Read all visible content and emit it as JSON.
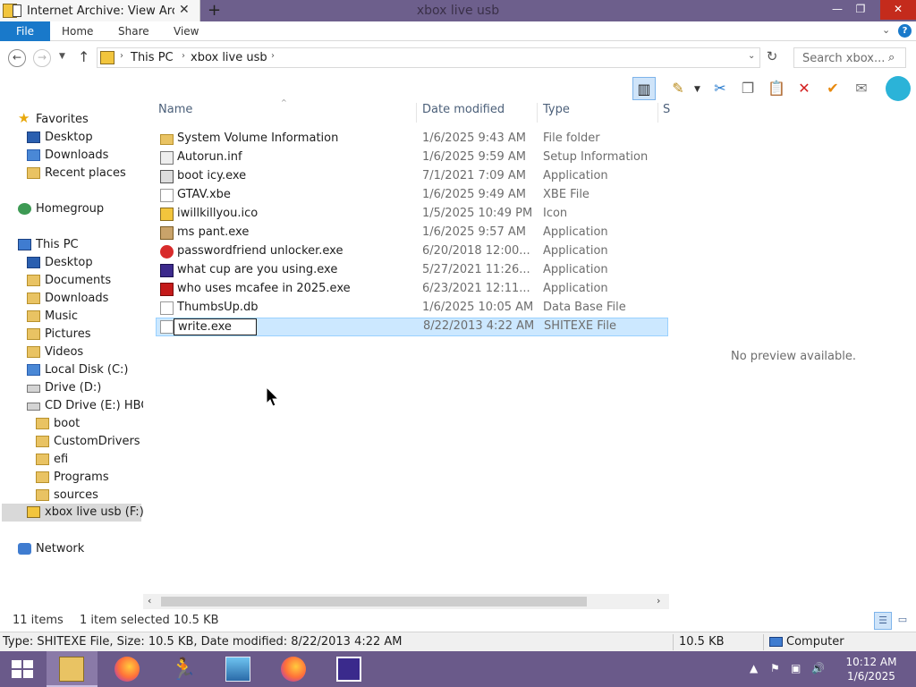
{
  "window": {
    "tab_title": "Internet Archive: View Arc",
    "title": "xbox live usb",
    "min": "—",
    "max": "❐",
    "close": "✕",
    "newtab": "+"
  },
  "ribbon": {
    "tabs": [
      "File",
      "Home",
      "Share",
      "View"
    ]
  },
  "address": {
    "crumbs": [
      "This PC",
      "xbox live usb"
    ],
    "search_placeholder": "Search xbox..."
  },
  "columns": {
    "name": "Name",
    "date": "Date modified",
    "type": "Type",
    "size": "S"
  },
  "nav": {
    "favorites": "Favorites",
    "favorites_items": [
      "Desktop",
      "Downloads",
      "Recent places"
    ],
    "homegroup": "Homegroup",
    "this_pc": "This PC",
    "pc_items": [
      "Desktop",
      "Documents",
      "Downloads",
      "Music",
      "Pictures",
      "Videos",
      "Local Disk (C:)",
      "Drive (D:)",
      "CD Drive (E:) HBCD"
    ],
    "cd_items": [
      "boot",
      "CustomDrivers",
      "efi",
      "Programs",
      "sources"
    ],
    "usb": "xbox live usb (F:)",
    "network": "Network"
  },
  "files": [
    {
      "name": "System Volume Information",
      "date": "1/6/2025 9:43 AM",
      "type": "File folder",
      "icon": "folder"
    },
    {
      "name": "Autorun.inf",
      "date": "1/6/2025 9:59 AM",
      "type": "Setup Information",
      "icon": "inf"
    },
    {
      "name": "boot icy.exe",
      "date": "7/1/2021 7:09 AM",
      "type": "Application",
      "icon": "exe"
    },
    {
      "name": "GTAV.xbe",
      "date": "1/6/2025 9:49 AM",
      "type": "XBE File",
      "icon": "file"
    },
    {
      "name": "iwillkillyou.ico",
      "date": "1/5/2025 10:49 PM",
      "type": "Icon",
      "icon": "ico"
    },
    {
      "name": "ms pant.exe",
      "date": "1/6/2025 9:57 AM",
      "type": "Application",
      "icon": "pant"
    },
    {
      "name": "passwordfriend unlocker.exe",
      "date": "6/20/2018 12:00...",
      "type": "Application",
      "icon": "pw"
    },
    {
      "name": "what cup are you using.exe",
      "date": "5/27/2021 11:26...",
      "type": "Application",
      "icon": "cup"
    },
    {
      "name": "who uses mcafee in 2025.exe",
      "date": "6/23/2021 12:11...",
      "type": "Application",
      "icon": "mcafee"
    },
    {
      "name": "ThumbsUp.db",
      "date": "1/6/2025 10:05 AM",
      "type": "Data Base File",
      "icon": "file"
    },
    {
      "name": "write.exe",
      "date": "8/22/2013 4:22 AM",
      "type": "SHITEXE File",
      "icon": "file",
      "selected": true,
      "renaming": true
    }
  ],
  "preview": {
    "text": "No preview available."
  },
  "status": {
    "count": "11 items",
    "selected": "1 item selected",
    "size": "10.5 KB"
  },
  "infobar": {
    "details": "Type: SHITEXE File, Size: 10.5 KB, Date modified: 8/22/2013 4:22 AM",
    "size": "10.5 KB",
    "location": "Computer"
  },
  "taskbar": {
    "time": "10:12 AM",
    "date": "1/6/2025",
    "apps": [
      "start",
      "explorer",
      "firefox",
      "runner",
      "photo",
      "firefox",
      "chip"
    ]
  },
  "colors": {
    "titlebar": "#6d5f8c",
    "file_tab": "#1979ca",
    "selection": "#cce8ff",
    "taskbar": "#6a5a8a"
  },
  "icons": {
    "back": "back-arrow-icon",
    "forward": "forward-arrow-icon",
    "up": "up-arrow-icon",
    "refresh": "refresh-icon",
    "search": "search-icon",
    "help": "help-icon"
  }
}
